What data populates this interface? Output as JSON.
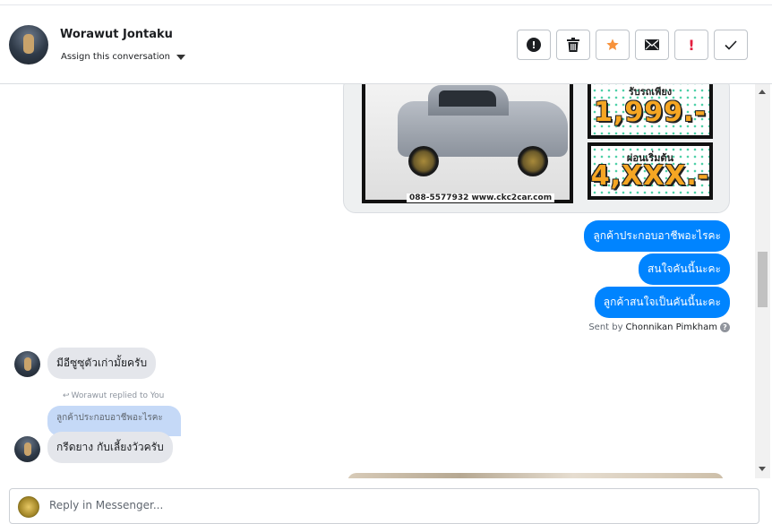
{
  "header": {
    "contact_name": "Worawut Jontaku",
    "assign_label": "Assign this conversation",
    "actions": [
      {
        "name": "spam-button",
        "icon": "circle-exclamation-icon"
      },
      {
        "name": "delete-button",
        "icon": "trash-icon"
      },
      {
        "name": "star-button",
        "icon": "star-icon"
      },
      {
        "name": "mark-unread-button",
        "icon": "envelope-icon"
      },
      {
        "name": "mark-important-button",
        "icon": "exclamation-icon"
      },
      {
        "name": "mark-done-button",
        "icon": "check-icon"
      }
    ],
    "colors": {
      "star": "#f7923b",
      "important": "#e41e3f"
    }
  },
  "conversation": {
    "car_image": {
      "price_label": "รับรถเพียง",
      "price": "1,999.-",
      "installment_label": "ผ่อนเริ่มต้น",
      "installment": "4,XXX.-",
      "caption": "088-5577932 www.ckc2car.com"
    },
    "outgoing": [
      "ลูกค้าประกอบอาชีพอะไรคะ",
      "สนใจคันนี้นะคะ",
      "ลูกค้าสนใจเป็นคันนี้นะคะ"
    ],
    "sent_by_prefix": "Sent by",
    "sent_by_name": "Chonnikan Pimkham",
    "incoming_1": "มีอีซูซุตัวเก่ามั้ยครับ",
    "replied_note": "Worawut replied to You",
    "quoted_text": "ลูกค้าประกอบอาชีพอะไรคะ",
    "incoming_2": "กรีดยาง กับเลี้ยงวัวครับ",
    "colors": {
      "outgoing_bubble": "#0084ff",
      "incoming_bubble": "#e4e6eb",
      "quoted_bubble": "#c5d9f7"
    }
  },
  "composer": {
    "placeholder": "Reply in Messenger..."
  }
}
